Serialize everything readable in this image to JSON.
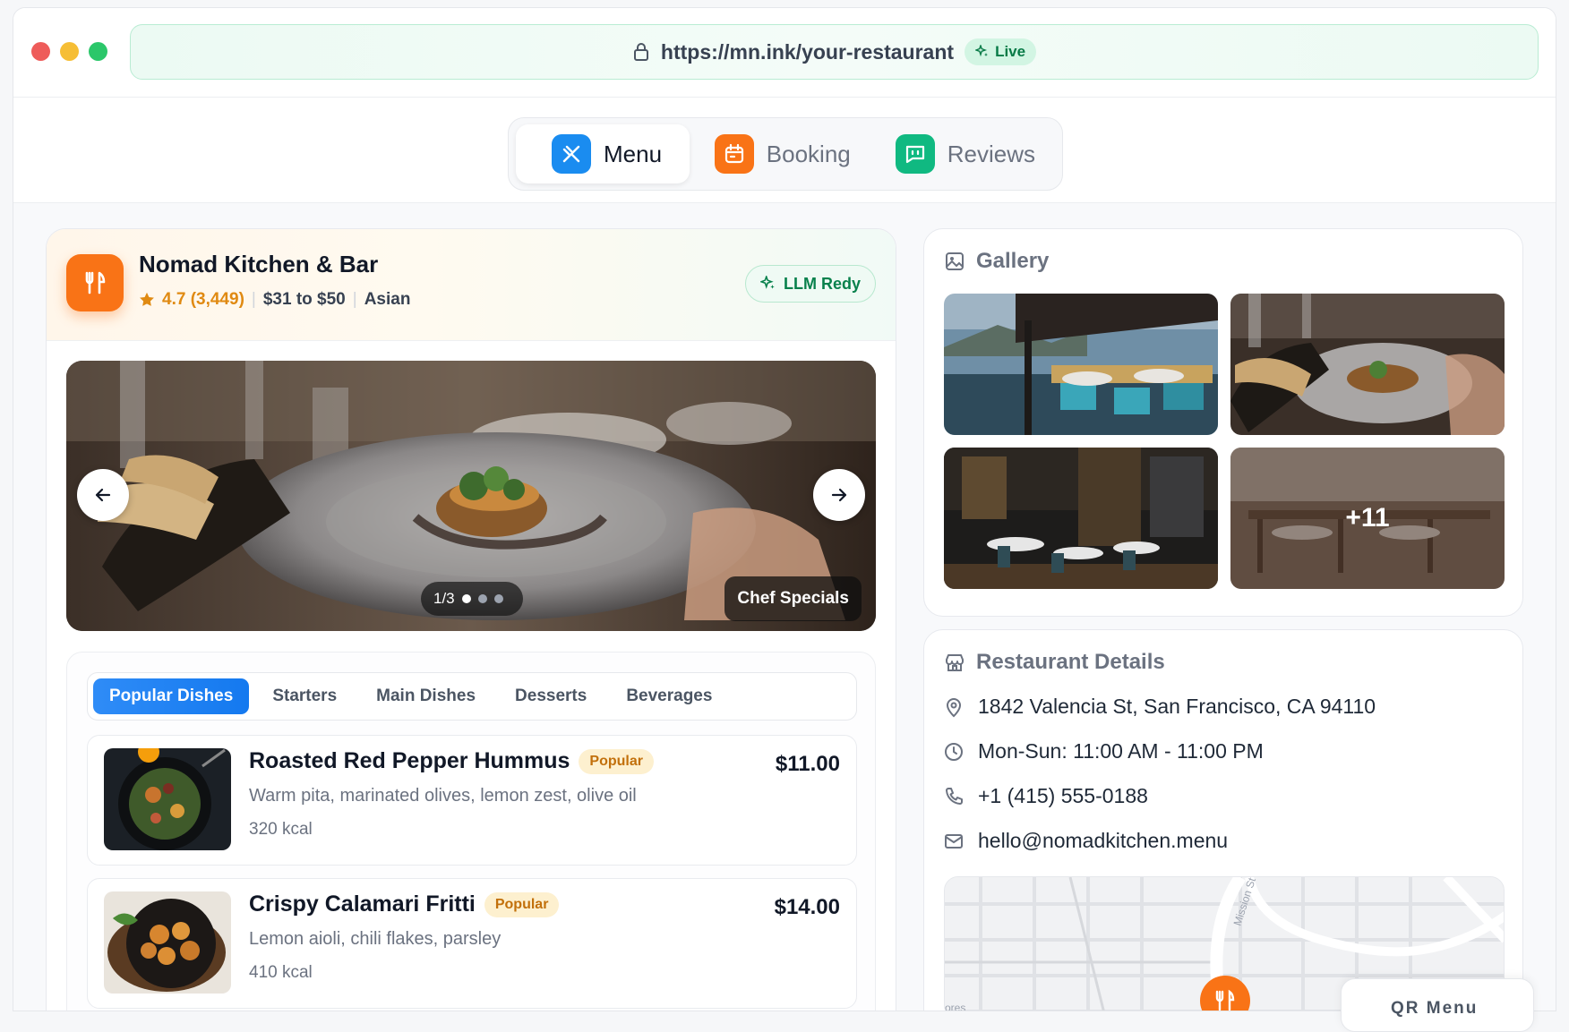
{
  "browser": {
    "url": "https://mn.ink/your-restaurant",
    "live_label": "Live",
    "colors": {
      "close": "#ee5c5a",
      "minimize": "#f6be35",
      "maximize": "#2bc76a"
    }
  },
  "nav": {
    "tabs": [
      {
        "label": "Menu",
        "icon": "utensils-icon",
        "color": "#1a8cf0",
        "active": true
      },
      {
        "label": "Booking",
        "icon": "calendar-icon",
        "color": "#f97316",
        "active": false
      },
      {
        "label": "Reviews",
        "icon": "chat-icon",
        "color": "#10b981",
        "active": false
      }
    ]
  },
  "restaurant": {
    "name": "Nomad Kitchen & Bar",
    "rating": "4.7 (3,449)",
    "price_range": "$31 to $50",
    "cuisine": "Asian",
    "llm_badge": "LLM Redy"
  },
  "hero": {
    "pager": "1/3",
    "caption": "Chef Specials"
  },
  "menu": {
    "categories": [
      "Popular Dishes",
      "Starters",
      "Main Dishes",
      "Desserts",
      "Beverages"
    ],
    "active_category": "Popular Dishes",
    "dishes": [
      {
        "name": "Roasted Red Pepper Hummus",
        "badge": "Popular",
        "desc": "Warm pita, marinated olives, lemon zest, olive oil",
        "kcal": "320 kcal",
        "price": "$11.00"
      },
      {
        "name": "Crispy Calamari Fritti",
        "badge": "Popular",
        "desc": "Lemon aioli, chili flakes, parsley",
        "kcal": "410 kcal",
        "price": "$14.00"
      }
    ]
  },
  "gallery": {
    "title": "Gallery",
    "more_count": "+11"
  },
  "details": {
    "title": "Restaurant Details",
    "address": "1842 Valencia St, San Francisco, CA 94110",
    "hours": "Mon-Sun: 11:00 AM - 11:00 PM",
    "phone": "+1 (415) 555-0188",
    "email": "hello@nomadkitchen.menu"
  },
  "map": {
    "street_label": "Mission St",
    "area_label": "ores"
  },
  "qr": {
    "label": "QR Menu"
  },
  "accent": {
    "orange": "#f97316",
    "blue": "#1a8cf0",
    "green": "#10b981"
  }
}
